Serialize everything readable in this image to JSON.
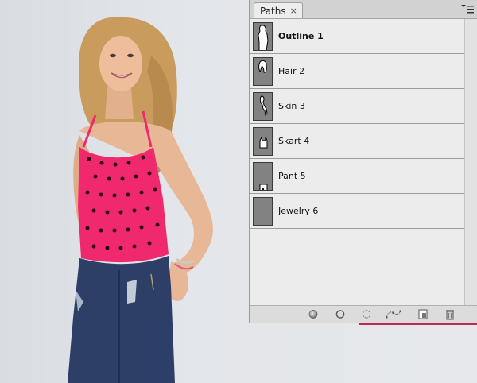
{
  "panel": {
    "tab_label": "Paths",
    "close_glyph": "×",
    "rows": [
      {
        "label": "Outline 1",
        "bold": true,
        "icon": "outline-path-thumbnail"
      },
      {
        "label": "Hair 2",
        "bold": false,
        "icon": "hair-path-thumbnail"
      },
      {
        "label": "Skin 3",
        "bold": false,
        "icon": "skin-path-thumbnail"
      },
      {
        "label": "Skart 4",
        "bold": false,
        "icon": "skart-path-thumbnail"
      },
      {
        "label": "Pant 5",
        "bold": false,
        "icon": "pant-path-thumbnail"
      },
      {
        "label": "Jewelry 6",
        "bold": false,
        "icon": "jewelry-path-thumbnail"
      }
    ],
    "bottom_buttons": [
      "fill-path-icon",
      "stroke-path-icon",
      "load-selection-icon",
      "make-work-path-icon",
      "new-path-icon",
      "delete-path-icon"
    ]
  },
  "colors": {
    "top": "#f0286e",
    "jeans": "#2d3f66",
    "hair": "#c99c5e",
    "skin": "#e8b896"
  }
}
